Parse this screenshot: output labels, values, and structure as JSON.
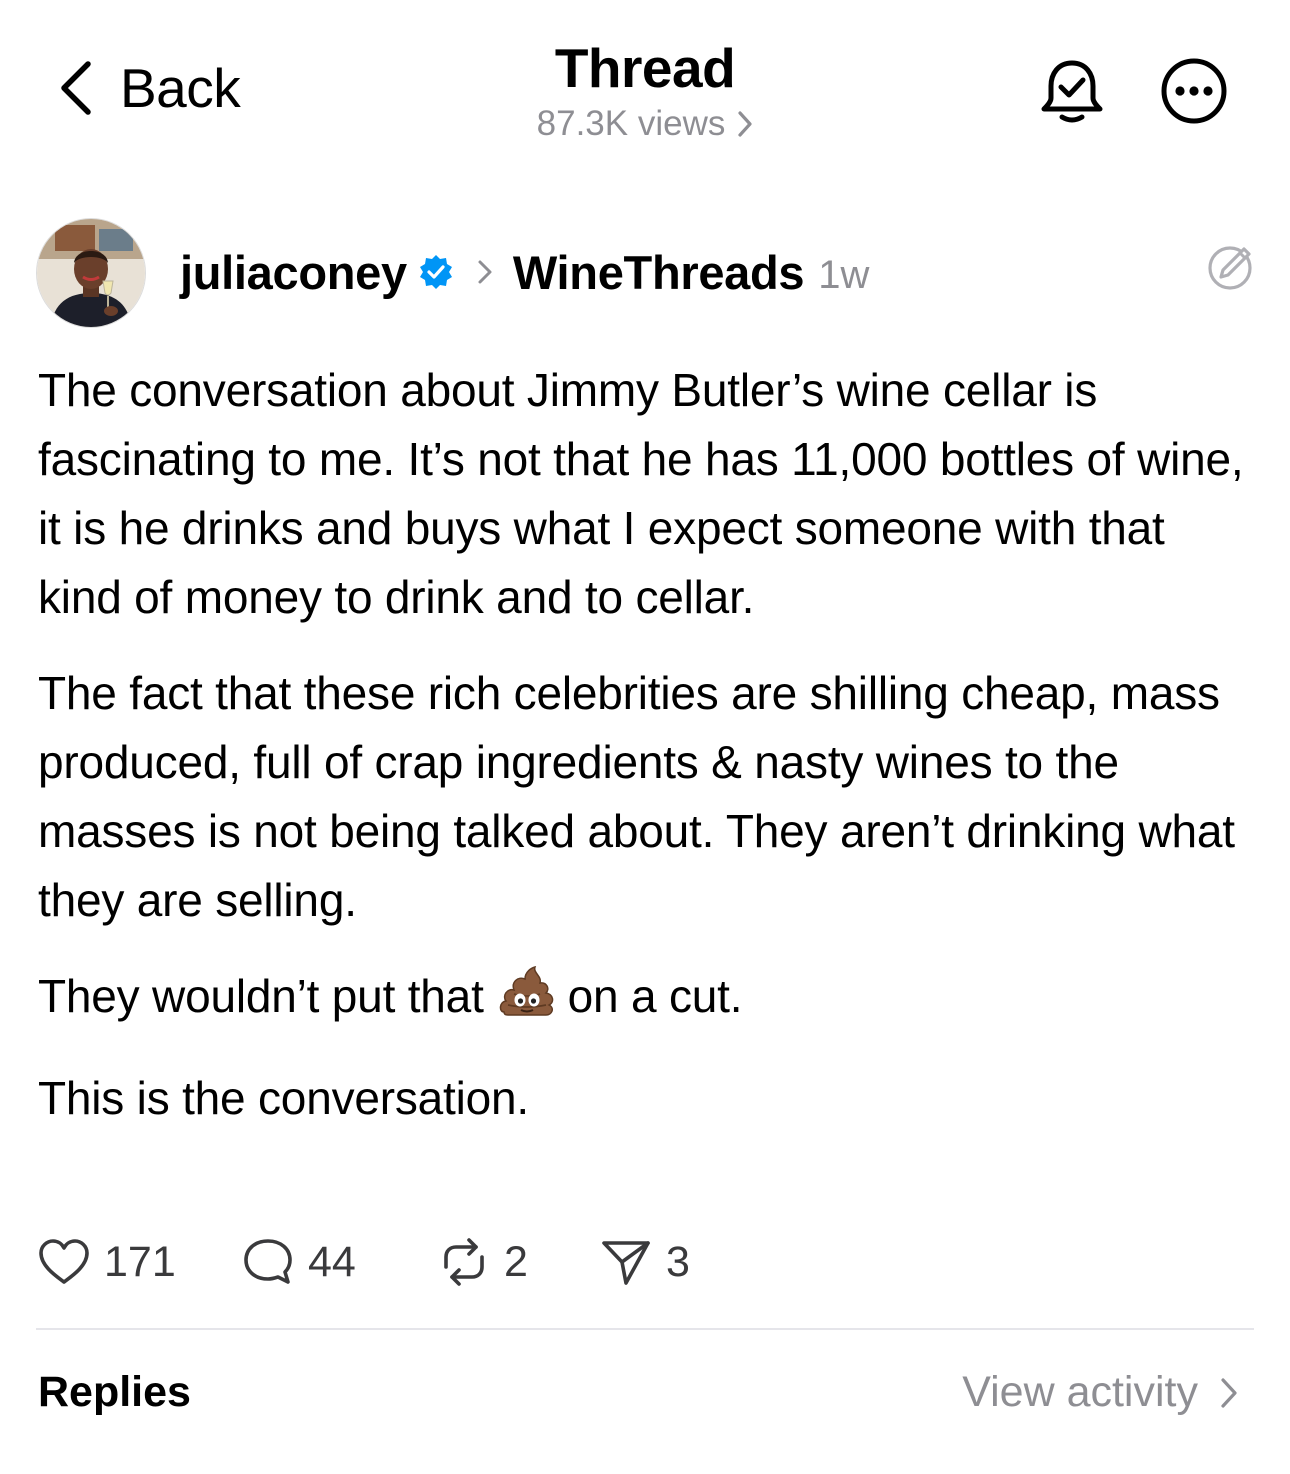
{
  "header": {
    "back_label": "Back",
    "title": "Thread",
    "views": "87.3K views",
    "icons": [
      "chevron-left-icon",
      "bell-check-icon",
      "more-icon",
      "chevron-right-icon"
    ]
  },
  "post": {
    "username": "juliaconey",
    "verified": true,
    "community": "WineThreads",
    "age": "1w",
    "paragraphs": [
      "The conversation about Jimmy Butler’s wine cellar is fascinating to me. It’s not that he has 11,000 bottles of wine, it is he drinks and buys what I expect someone with that kind of money to drink and to cellar.",
      "The fact that these rich celebrities are shilling cheap, mass produced, full of crap ingredients & nasty wines to the masses is not being talked about. They aren’t drinking what they are selling."
    ],
    "line3_before": "They wouldn’t put that",
    "line3_emoji": "💩",
    "line3_after": "on a cut.",
    "closing": "This is the conversation.",
    "stats": {
      "likes": "171",
      "replies": "44",
      "reposts": "2",
      "shares": "3"
    }
  },
  "footer": {
    "replies_label": "Replies",
    "view_activity_label": "View activity"
  },
  "colors": {
    "text": "#000000",
    "secondary": "#8e8e93",
    "verified": "#0095f6",
    "divider": "#e5e5ea"
  }
}
